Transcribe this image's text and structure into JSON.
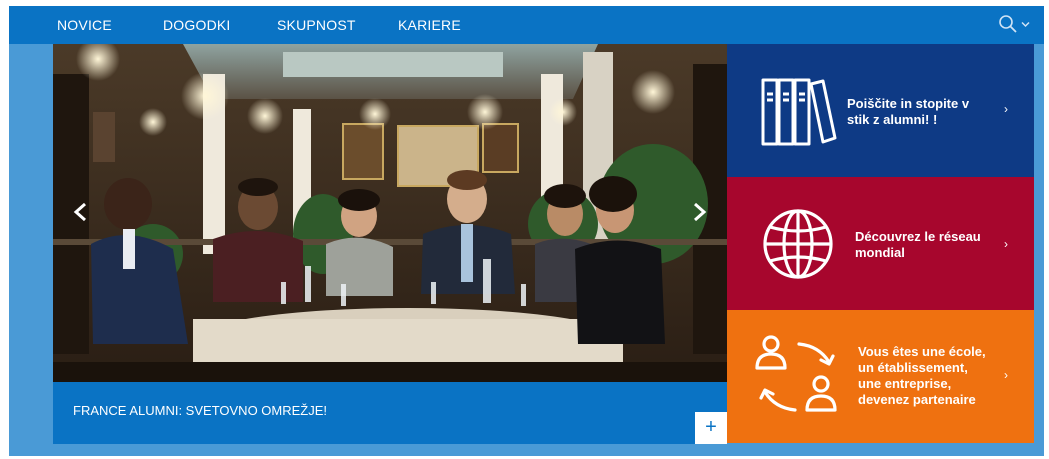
{
  "nav": {
    "items": [
      "NOVICE",
      "DOGODKI",
      "SKUPNOST",
      "KARIERE"
    ],
    "search_icon": "search-icon",
    "dropdown_icon": "chevron-down-icon"
  },
  "hero": {
    "caption": "FRANCE ALUMNI: SVETOVNO OMREŽJE!",
    "plus_label": "+",
    "prev_icon": "chevron-left-icon",
    "next_icon": "chevron-right-icon"
  },
  "tiles": [
    {
      "lines": [
        "Poiščite in stopite v",
        "stik z alumni! !"
      ],
      "icon": "books-icon",
      "chevron": "›",
      "color": "#0e3a85"
    },
    {
      "lines": [
        "Découvrez le réseau",
        "mondial"
      ],
      "icon": "globe-icon",
      "chevron": "›",
      "color": "#a7062d"
    },
    {
      "lines": [
        "Vous êtes une école,",
        "un établissement,",
        "une entreprise,",
        "devenez partenaire"
      ],
      "icon": "people-exchange-icon",
      "chevron": "›",
      "color": "#ef7110"
    }
  ],
  "colors": {
    "nav_bg": "#0a73c4",
    "frame_bg": "#4a9ad6",
    "tile_blue": "#0e3a85",
    "tile_red": "#a7062d",
    "tile_orange": "#ef7110"
  }
}
